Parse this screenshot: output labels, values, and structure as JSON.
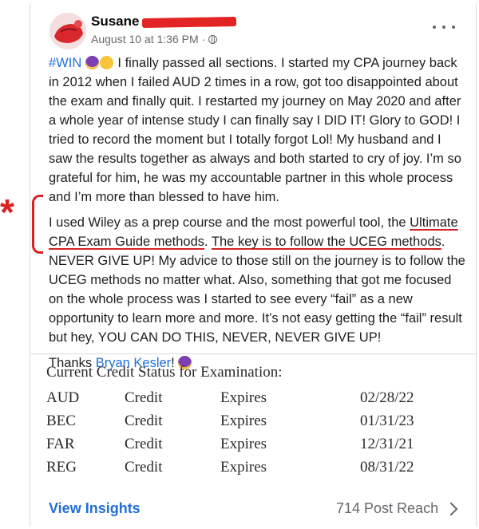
{
  "post": {
    "author_name": "Susane",
    "timestamp": "August 10 at 1:36 PM",
    "audience_icon": "globe-icon",
    "hashtag": "#WIN",
    "paragraph1_text": " I finally passed all sections. I started my CPA journey back in 2012 when I failed AUD 2 times in a row, got too disappointed about the exam and finally quit. I restarted my journey on May 2020 and after a whole year of intense study I can finally say I DID IT! Glory to GOD! I tried to record the moment but I totally forgot Lol! My husband and I saw the results together as always and both started to cry of joy. I’m so grateful for him, he was my accountable partner in this whole process and I’m more than blessed to have him.",
    "paragraph2_a": "I used Wiley as a prep course and the most powerful tool, the ",
    "paragraph2_u1": "Ultimate CPA Exam Guide methods",
    "paragraph2_b": ". ",
    "paragraph2_u2": "The key is to follow the UCEG methods",
    "paragraph2_c": ". NEVER GIVE UP! My advice to those still on the journey is to follow the UCEG methods no matter what. Also, something that got me focused on the whole process was I started to see every “fail” as a new opportunity to learn more and more. It’s not easy getting the “fail” result but hey, YOU CAN DO THIS, NEVER, NEVER GIVE UP!",
    "thanks_prefix": "Thanks ",
    "mention": "Bryan Kesler",
    "thanks_suffix": "!"
  },
  "annotation": {
    "mark": "*",
    "color": "#d92121"
  },
  "credit_status": {
    "title": "Current Credit Status for Examination:",
    "rows": [
      {
        "section": "AUD",
        "status": "Credit",
        "label": "Expires",
        "date": "02/28/22"
      },
      {
        "section": "BEC",
        "status": "Credit",
        "label": "Expires",
        "date": "01/31/23"
      },
      {
        "section": "FAR",
        "status": "Credit",
        "label": "Expires",
        "date": "12/31/21"
      },
      {
        "section": "REG",
        "status": "Credit",
        "label": "Expires",
        "date": "08/31/22"
      }
    ]
  },
  "footer": {
    "insights_label": "View Insights",
    "reach_label": "714 Post Reach"
  },
  "colors": {
    "link": "#216fdb",
    "muted": "#65676b",
    "annotation": "#d92121"
  }
}
